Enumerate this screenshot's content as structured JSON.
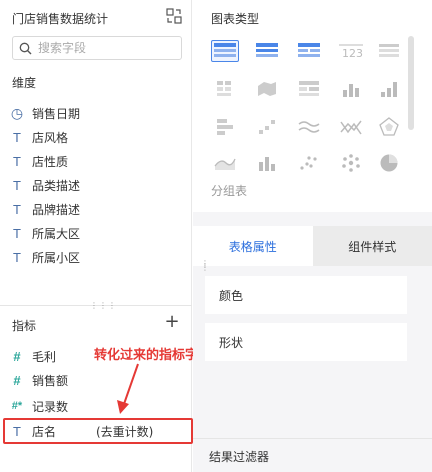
{
  "left_panel": {
    "title": "门店销售数据统计",
    "search_placeholder": "搜索字段",
    "dimensions_title": "维度",
    "dimensions": [
      {
        "icon": "clock-icon",
        "glyph": "◷",
        "label": "销售日期"
      },
      {
        "icon": "text-field-icon",
        "glyph": "T",
        "label": "店风格"
      },
      {
        "icon": "text-field-icon",
        "glyph": "T",
        "label": "店性质"
      },
      {
        "icon": "text-field-icon",
        "glyph": "T",
        "label": "品类描述"
      },
      {
        "icon": "text-field-icon",
        "glyph": "T",
        "label": "品牌描述"
      },
      {
        "icon": "text-field-icon",
        "glyph": "T",
        "label": "所属大区"
      },
      {
        "icon": "text-field-icon",
        "glyph": "T",
        "label": "所属小区"
      }
    ],
    "metrics_title": "指标",
    "add_glyph": "+",
    "metrics": [
      {
        "icon": "number-field-icon",
        "glyph": "#",
        "label": "毛利"
      },
      {
        "icon": "number-field-icon",
        "glyph": "#",
        "label": "销售额"
      },
      {
        "icon": "record-count-icon",
        "glyph": "#*",
        "label": "记录数"
      }
    ],
    "converted_field": {
      "glyph": "T",
      "label": "店名",
      "suffix": "(去重计数)"
    },
    "annotation": "转化过来的指标字段"
  },
  "right_panel": {
    "chart_type_title": "图表类型",
    "group_label": "分组表",
    "tabs": [
      {
        "label": "表格属性",
        "active": true
      },
      {
        "label": "组件样式",
        "active": false
      }
    ],
    "properties": [
      "颜色",
      "形状"
    ],
    "filter_title": "结果过滤器"
  },
  "colors": {
    "accent": "#2c6fdd",
    "highlight": "#e53935",
    "number_icon": "#2aa69a",
    "text_icon": "#4a6fa5"
  }
}
